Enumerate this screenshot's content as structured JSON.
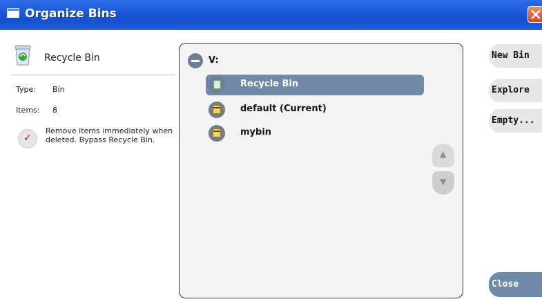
{
  "window": {
    "title": "Organize Bins"
  },
  "left": {
    "selected_name": "Recycle Bin",
    "type_label": "Type:",
    "type_value": "Bin",
    "items_label": "Items:",
    "items_value": "8",
    "option_text": "Remove items immediately when deleted. Bypass Recycle Bin."
  },
  "tree": {
    "root": "V:",
    "items": [
      {
        "label": "Recycle Bin"
      },
      {
        "label": "default (Current)"
      },
      {
        "label": "mybin"
      }
    ]
  },
  "buttons": {
    "new_bin": "New Bin",
    "explore": "Explore",
    "empty": "Empty...",
    "close": "Close"
  },
  "colors": {
    "titlebar": "#1958d8",
    "selected": "#6f8aa8",
    "panel_bg": "#f4f4f4"
  }
}
